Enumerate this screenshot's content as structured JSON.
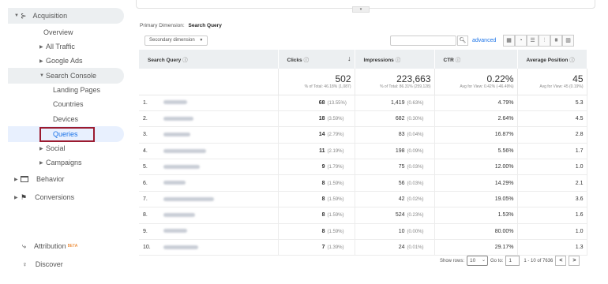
{
  "sidebar": {
    "acquisition": "Acquisition",
    "overview": "Overview",
    "all_traffic": "All Traffic",
    "google_ads": "Google Ads",
    "search_console": "Search Console",
    "landing_pages": "Landing Pages",
    "countries": "Countries",
    "devices": "Devices",
    "queries": "Queries",
    "social": "Social",
    "campaigns": "Campaigns",
    "behavior": "Behavior",
    "conversions": "Conversions",
    "attribution": "Attribution",
    "beta": "BETA",
    "discover": "Discover"
  },
  "toolbar": {
    "primary_dimension_label": "Primary Dimension:",
    "primary_dimension_value": "Search Query",
    "secondary_dimension": "Secondary dimension",
    "advanced": "advanced"
  },
  "table": {
    "headers": {
      "query": "Search Query",
      "clicks": "Clicks",
      "impressions": "Impressions",
      "ctr": "CTR",
      "position": "Average Position"
    },
    "totals": {
      "clicks": "502",
      "clicks_sub": "% of Total: 46.18% (1,087)",
      "impressions": "223,663",
      "impressions_sub": "% of Total: 86.31% (259,128)",
      "ctr": "0.22%",
      "ctr_sub": "Avg for View: 0.42% (-46.49%)",
      "position": "45",
      "position_sub": "Avg for View: 45 (0.19%)"
    },
    "rows": [
      {
        "n": "1.",
        "clicks": "68",
        "clicks_pct": "(13.55%)",
        "imp": "1,419",
        "imp_pct": "(0.63%)",
        "ctr": "4.79%",
        "pos": "5.3"
      },
      {
        "n": "2.",
        "clicks": "18",
        "clicks_pct": "(3.59%)",
        "imp": "682",
        "imp_pct": "(0.30%)",
        "ctr": "2.64%",
        "pos": "4.5"
      },
      {
        "n": "3.",
        "clicks": "14",
        "clicks_pct": "(2.79%)",
        "imp": "83",
        "imp_pct": "(0.04%)",
        "ctr": "16.87%",
        "pos": "2.8"
      },
      {
        "n": "4.",
        "clicks": "11",
        "clicks_pct": "(2.19%)",
        "imp": "198",
        "imp_pct": "(0.09%)",
        "ctr": "5.56%",
        "pos": "1.7"
      },
      {
        "n": "5.",
        "clicks": "9",
        "clicks_pct": "(1.79%)",
        "imp": "75",
        "imp_pct": "(0.03%)",
        "ctr": "12.00%",
        "pos": "1.0"
      },
      {
        "n": "6.",
        "clicks": "8",
        "clicks_pct": "(1.59%)",
        "imp": "56",
        "imp_pct": "(0.03%)",
        "ctr": "14.29%",
        "pos": "2.1"
      },
      {
        "n": "7.",
        "clicks": "8",
        "clicks_pct": "(1.59%)",
        "imp": "42",
        "imp_pct": "(0.02%)",
        "ctr": "19.05%",
        "pos": "3.6"
      },
      {
        "n": "8.",
        "clicks": "8",
        "clicks_pct": "(1.59%)",
        "imp": "524",
        "imp_pct": "(0.23%)",
        "ctr": "1.53%",
        "pos": "1.6"
      },
      {
        "n": "9.",
        "clicks": "8",
        "clicks_pct": "(1.59%)",
        "imp": "10",
        "imp_pct": "(0.00%)",
        "ctr": "80.00%",
        "pos": "1.0"
      },
      {
        "n": "10.",
        "clicks": "7",
        "clicks_pct": "(1.39%)",
        "imp": "24",
        "imp_pct": "(0.01%)",
        "ctr": "29.17%",
        "pos": "1.3"
      }
    ]
  },
  "pager": {
    "show_rows_label": "Show rows:",
    "show_rows_value": "10",
    "goto_label": "Go to:",
    "goto_value": "1",
    "range": "1 - 10 of 7636",
    "prev": "<",
    "next": ">"
  },
  "colors": {
    "accent": "#1a73e8",
    "highlight_box": "#9b1b30",
    "header_bg": "#eceff1"
  }
}
